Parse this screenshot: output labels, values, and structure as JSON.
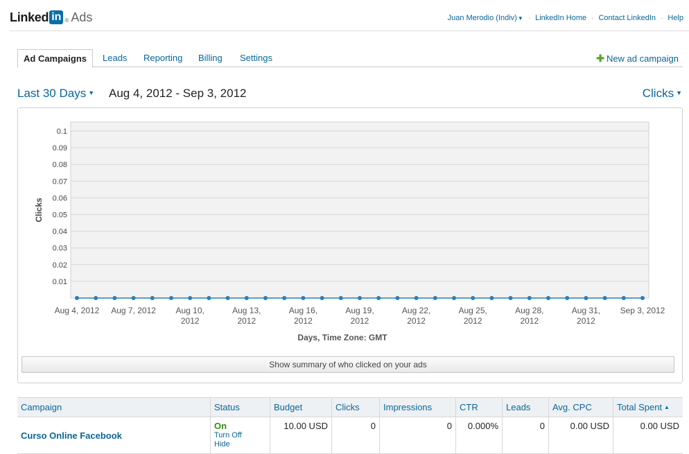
{
  "header": {
    "logo_linked": "Linked",
    "logo_in": "in",
    "logo_reg": "®",
    "logo_ads": "Ads",
    "user_menu": "Juan Merodio (Indiv)",
    "links": [
      "LinkedIn Home",
      "Contact LinkedIn",
      "Help"
    ]
  },
  "tabs": [
    "Ad Campaigns",
    "Leads",
    "Reporting",
    "Billing",
    "Settings"
  ],
  "new_campaign": "New ad campaign",
  "range": {
    "label": "Last 30 Days",
    "dates": "Aug 4, 2012 - Sep 3, 2012",
    "metric": "Clicks"
  },
  "chart_data": {
    "type": "line",
    "ylabel": "Clicks",
    "xlabel": "Days, Time Zone: GMT",
    "ylim": [
      0,
      0.1
    ],
    "y_ticks": [
      "0.1",
      "0.09",
      "0.08",
      "0.07",
      "0.06",
      "0.05",
      "0.04",
      "0.03",
      "0.02",
      "0.01"
    ],
    "x_tick_labels": [
      [
        "Aug 4, 2012"
      ],
      [
        "Aug 7, 2012"
      ],
      [
        "Aug 10,",
        "2012"
      ],
      [
        "Aug 13,",
        "2012"
      ],
      [
        "Aug 16,",
        "2012"
      ],
      [
        "Aug 19,",
        "2012"
      ],
      [
        "Aug 22,",
        "2012"
      ],
      [
        "Aug 25,",
        "2012"
      ],
      [
        "Aug 28,",
        "2012"
      ],
      [
        "Aug 31,",
        "2012"
      ],
      [
        "Sep 3, 2012"
      ]
    ],
    "x": [
      "Aug 4",
      "Aug 5",
      "Aug 6",
      "Aug 7",
      "Aug 8",
      "Aug 9",
      "Aug 10",
      "Aug 11",
      "Aug 12",
      "Aug 13",
      "Aug 14",
      "Aug 15",
      "Aug 16",
      "Aug 17",
      "Aug 18",
      "Aug 19",
      "Aug 20",
      "Aug 21",
      "Aug 22",
      "Aug 23",
      "Aug 24",
      "Aug 25",
      "Aug 26",
      "Aug 27",
      "Aug 28",
      "Aug 29",
      "Aug 30",
      "Aug 31",
      "Sep 1",
      "Sep 2",
      "Sep 3"
    ],
    "series": [
      {
        "values": [
          0,
          0,
          0,
          0,
          0,
          0,
          0,
          0,
          0,
          0,
          0,
          0,
          0,
          0,
          0,
          0,
          0,
          0,
          0,
          0,
          0,
          0,
          0,
          0,
          0,
          0,
          0,
          0,
          0,
          0,
          0
        ]
      }
    ],
    "grid": true,
    "colors": {
      "line": "#2a7fb8",
      "plot_bg": "#f2f2f2",
      "grid": "#d8d8d8"
    }
  },
  "summary_button": "Show summary of who clicked on your ads",
  "table": {
    "headers": [
      "Campaign",
      "Status",
      "Budget",
      "Clicks",
      "Impressions",
      "CTR",
      "Leads",
      "Avg. CPC",
      "Total Spent"
    ],
    "sort_indicator": "▲",
    "rows": [
      {
        "campaign": "Curso Online Facebook",
        "status": "On",
        "status_links": [
          "Turn Off",
          "Hide"
        ],
        "budget": "10.00 USD",
        "clicks": "0",
        "impressions": "0",
        "ctr": "0.000%",
        "leads": "0",
        "avg_cpc": "0.00 USD",
        "total_spent": "0.00 USD"
      }
    ]
  }
}
